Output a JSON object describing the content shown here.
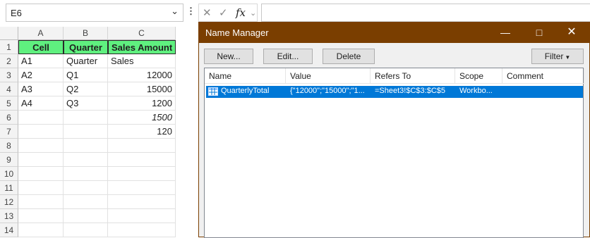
{
  "formula_bar": {
    "name_box": "E6",
    "fx_label": "fx",
    "formula": ""
  },
  "sheet": {
    "columns": [
      "A",
      "B",
      "C"
    ],
    "rows": [
      "1",
      "2",
      "3",
      "4",
      "5",
      "6",
      "7",
      "8",
      "9",
      "10",
      "11",
      "12",
      "13",
      "14"
    ],
    "cells": [
      [
        "Cell",
        "Quarter",
        "Sales Amount"
      ],
      [
        "A1",
        "Quarter",
        "Sales"
      ],
      [
        "A2",
        "Q1",
        "12000"
      ],
      [
        "A3",
        "Q2",
        "15000"
      ],
      [
        "A4",
        "Q3",
        "1200"
      ],
      [
        "",
        "",
        "1500"
      ],
      [
        "",
        "",
        "120"
      ]
    ],
    "header_fill": "#5ff07f",
    "selected_cell": "E6"
  },
  "name_manager": {
    "title": "Name Manager",
    "title_bar_color": "#7a3e00",
    "buttons": {
      "new": "New...",
      "edit": "Edit...",
      "delete": "Delete",
      "filter": "Filter"
    },
    "list_headers": [
      "Name",
      "Value",
      "Refers To",
      "Scope",
      "Comment"
    ],
    "rows": [
      {
        "name": "QuarterlyTotal",
        "value": "{\"12000\";\"15000\";\"1...",
        "refers_to": "=Sheet3!$C$3:$C$5",
        "scope": "Workbo...",
        "comment": ""
      }
    ],
    "selection_color": "#0078d7"
  }
}
